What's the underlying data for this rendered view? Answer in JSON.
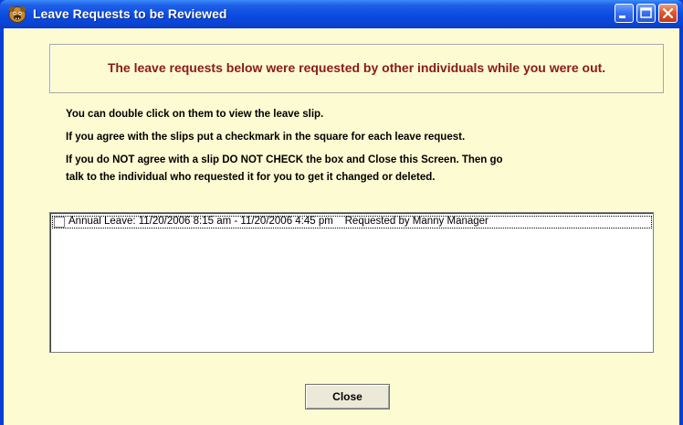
{
  "window": {
    "title": "Leave Requests to be Reviewed",
    "app_icon": "bulldog-face-icon",
    "controls": [
      "minimize-icon",
      "maximize-icon",
      "close-icon"
    ]
  },
  "banner": {
    "text": "The leave requests below were requested by other individuals while you were out."
  },
  "instructions": {
    "line1": "You can double click on them to view the leave slip.",
    "line2": "If you agree with the slips put a checkmark in the square for each leave request.",
    "line3": "If you do NOT agree with a slip DO NOT CHECK the box and Close this Screen.  Then go",
    "line4": "talk to the individual who requested it for you to get it changed or deleted."
  },
  "list": {
    "items": [
      {
        "checked": false,
        "text": "Annual Leave: 11/20/2006 8:15 am - 11/20/2006 4:45 pm    Requested by Manny Manager"
      }
    ]
  },
  "buttons": {
    "close_label": "Close"
  },
  "colors": {
    "titlebar": "#0a4be0",
    "client_bg": "#fdfbd2",
    "banner_text": "#8a1a1a"
  }
}
